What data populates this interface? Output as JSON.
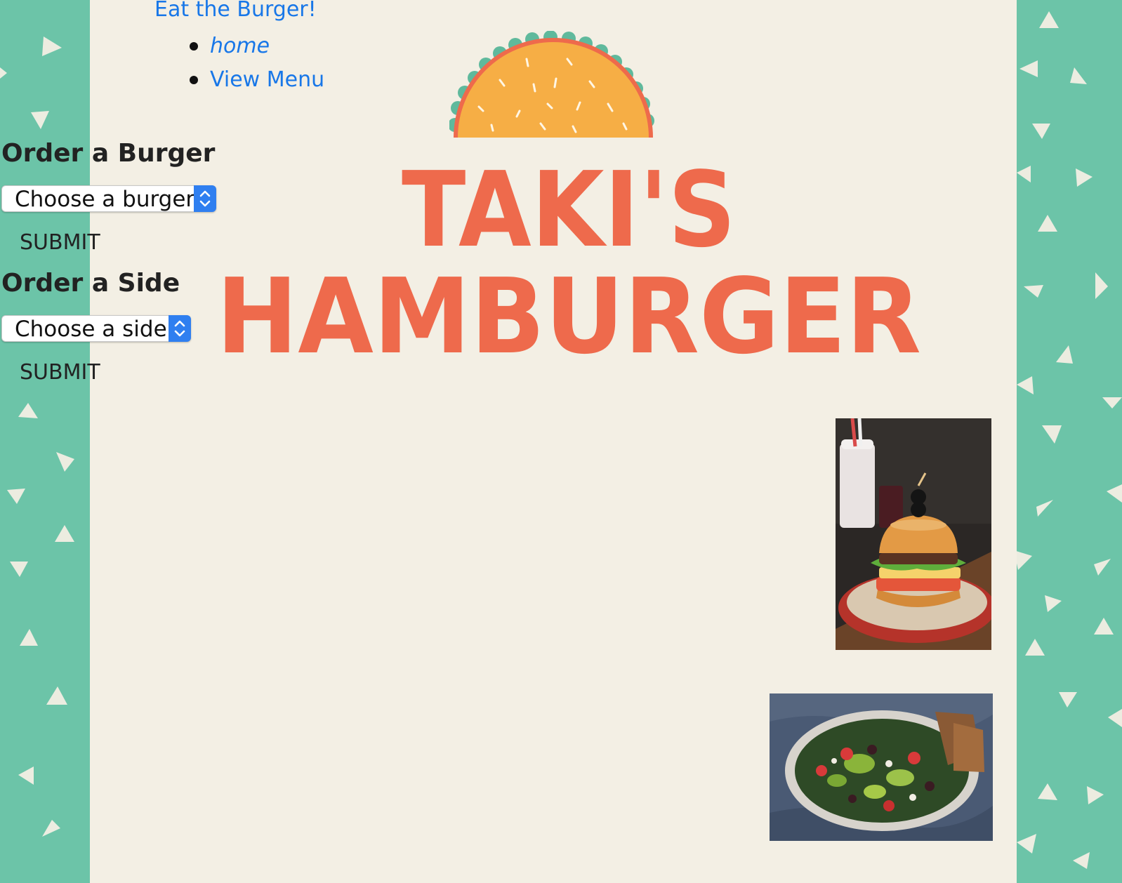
{
  "brand": "Eat the Burger!",
  "nav": {
    "items": [
      {
        "label": "home"
      },
      {
        "label": "View Menu"
      }
    ]
  },
  "burger_order": {
    "heading": "Order a Burger",
    "select_value": "Choose a burger",
    "submit_label": "SUBMIT"
  },
  "side_order": {
    "heading": "Order a Side",
    "select_value": "Choose a side",
    "submit_label": "SUBMIT"
  },
  "logo": {
    "line1": "TAKI'S",
    "line2": "HAMBURGER"
  },
  "colors": {
    "accent_green": "#6cc4a8",
    "page_background": "#f3efe4",
    "link_blue": "#1877e8",
    "logo_orange": "#ee6a4c",
    "taco_yellow": "#f6ae45"
  }
}
